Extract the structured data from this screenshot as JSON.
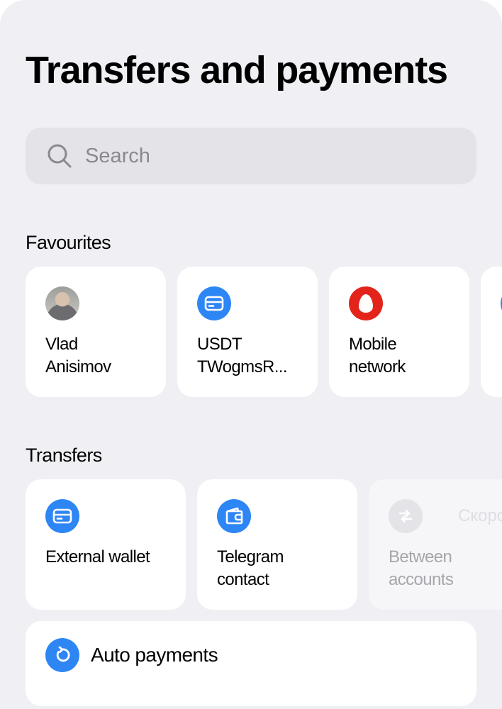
{
  "header": {
    "title": "Transfers and payments"
  },
  "search": {
    "placeholder": "Search",
    "icon": "search-icon"
  },
  "favourites": {
    "title": "Favourites",
    "items": [
      {
        "line1": "Vlad",
        "line2": "Anisimov",
        "icon": "avatar"
      },
      {
        "line1": "USDT",
        "line2": "TWogmsR...",
        "icon": "card-icon"
      },
      {
        "line1": "Mobile",
        "line2": "network",
        "icon": "mts-egg-icon"
      }
    ]
  },
  "transfers": {
    "title": "Transfers",
    "items": [
      {
        "line1": "External wallet",
        "line2": "",
        "icon": "card-icon"
      },
      {
        "line1": "Telegram",
        "line2": "contact",
        "icon": "wallet-icon"
      },
      {
        "line1": "Between",
        "line2": "accounts",
        "icon": "swap-arrows-icon",
        "badge": "Скоро"
      }
    ]
  },
  "auto_payments": {
    "label": "Auto payments",
    "icon": "refresh-icon"
  },
  "colors": {
    "accent": "#2e86f5",
    "background": "#efeff4",
    "card": "#ffffff",
    "mobile_brand": "#e3241b"
  }
}
